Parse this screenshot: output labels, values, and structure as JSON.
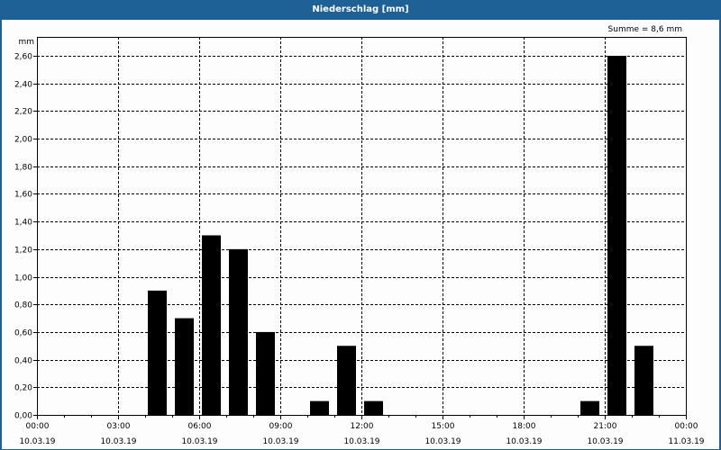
{
  "window": {
    "title": "Niederschlag [mm]"
  },
  "summary": "Summe = 8,6 mm",
  "chart_data": {
    "type": "bar",
    "title": "Niederschlag [mm]",
    "ylabel": "mm",
    "xlabel": "",
    "ylim": [
      0,
      2.6
    ],
    "xlim_hours": [
      0,
      24
    ],
    "grid": true,
    "bar_color": "#000000",
    "y_ticks": [
      "0,00",
      "0,20",
      "0,40",
      "0,60",
      "0,80",
      "1,00",
      "1,20",
      "1,40",
      "1,60",
      "1,80",
      "2,00",
      "2,20",
      "2,40",
      "2,60"
    ],
    "x_ticks": [
      {
        "time": "00:00",
        "date": "10.03.19"
      },
      {
        "time": "03:00",
        "date": "10.03.19"
      },
      {
        "time": "06:00",
        "date": "10.03.19"
      },
      {
        "time": "09:00",
        "date": "10.03.19"
      },
      {
        "time": "12:00",
        "date": "10.03.19"
      },
      {
        "time": "15:00",
        "date": "10.03.19"
      },
      {
        "time": "18:00",
        "date": "10.03.19"
      },
      {
        "time": "21:00",
        "date": "10.03.19"
      },
      {
        "time": "00:00",
        "date": "11.03.19"
      }
    ],
    "bars": [
      {
        "hour": 4,
        "value": 0.9
      },
      {
        "hour": 5,
        "value": 0.7
      },
      {
        "hour": 6,
        "value": 1.3
      },
      {
        "hour": 7,
        "value": 1.2
      },
      {
        "hour": 8,
        "value": 0.6
      },
      {
        "hour": 10,
        "value": 0.1
      },
      {
        "hour": 11,
        "value": 0.5
      },
      {
        "hour": 12,
        "value": 0.1
      },
      {
        "hour": 20,
        "value": 0.1
      },
      {
        "hour": 21,
        "value": 2.6
      },
      {
        "hour": 22,
        "value": 0.5
      }
    ]
  }
}
